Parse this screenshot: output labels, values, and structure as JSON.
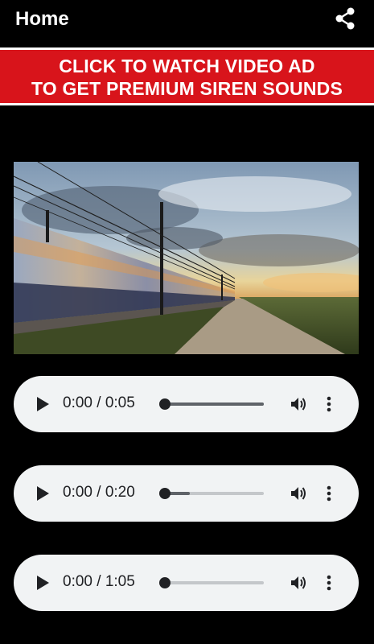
{
  "header": {
    "title": "Home",
    "share_icon": "share-icon"
  },
  "banner": {
    "line1": "CLICK TO WATCH VIDEO AD",
    "line2": "TO GET PREMIUM SIREN SOUNDS",
    "background_color": "#d8141b"
  },
  "hero_image": {
    "subject": "high-speed train on railway track beside country road at dusk"
  },
  "players": [
    {
      "time": "0:00 / 0:05",
      "progress_fraction": 0,
      "buffered_fraction": 1.0
    },
    {
      "time": "0:00 / 0:20",
      "progress_fraction": 0,
      "buffered_fraction": 0.25
    },
    {
      "time": "0:00 / 1:05",
      "progress_fraction": 0,
      "buffered_fraction": 0.0
    }
  ],
  "icons": {
    "play": "play-icon",
    "volume": "volume-icon",
    "more": "more-options-icon"
  }
}
